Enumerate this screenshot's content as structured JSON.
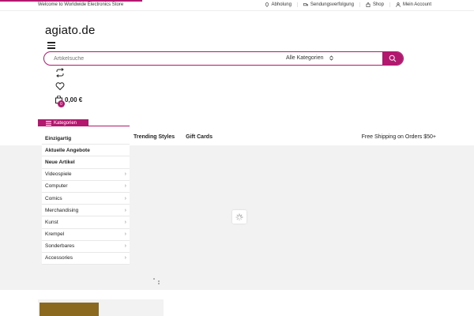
{
  "topbar": {
    "welcome": "Welcome to Worldwide Electronics Store",
    "links": [
      {
        "label": "Abholung",
        "icon": "map-pin-icon"
      },
      {
        "label": "Sendungsverfolgung",
        "icon": "truck-icon"
      },
      {
        "label": "Shop",
        "icon": "shopping-bag-icon"
      },
      {
        "label": "Mein Account",
        "icon": "user-icon"
      }
    ]
  },
  "header": {
    "logo": "agiato.de",
    "search_placeholder": "Artikelsuche",
    "category_select": "Alle Kategorien",
    "cart_total": "0,00 €",
    "cart_count": "0"
  },
  "nav": {
    "categories_label": "Kategorien",
    "links": [
      "Trending Styles",
      "Gift Cards"
    ],
    "free_shipping": "Free Shipping on Orders $50+"
  },
  "categories": [
    {
      "label": "Einzigartig",
      "bold": true,
      "chevron": false
    },
    {
      "label": "Aktuelle Angebote",
      "bold": true,
      "chevron": false
    },
    {
      "label": "Neue Artikel",
      "bold": true,
      "chevron": false
    },
    {
      "label": "Videospiele",
      "bold": false,
      "chevron": true
    },
    {
      "label": "Computer",
      "bold": false,
      "chevron": true
    },
    {
      "label": "Comics",
      "bold": false,
      "chevron": true
    },
    {
      "label": "Merchandising",
      "bold": false,
      "chevron": true
    },
    {
      "label": "Kunst",
      "bold": false,
      "chevron": true
    },
    {
      "label": "Krempel",
      "bold": false,
      "chevron": true
    },
    {
      "label": "Sonderbares",
      "bold": false,
      "chevron": true
    },
    {
      "label": "Accessories",
      "bold": false,
      "chevron": true
    }
  ],
  "colors": {
    "accent": "#b3186f",
    "hero_bg": "#f2f2f2"
  }
}
